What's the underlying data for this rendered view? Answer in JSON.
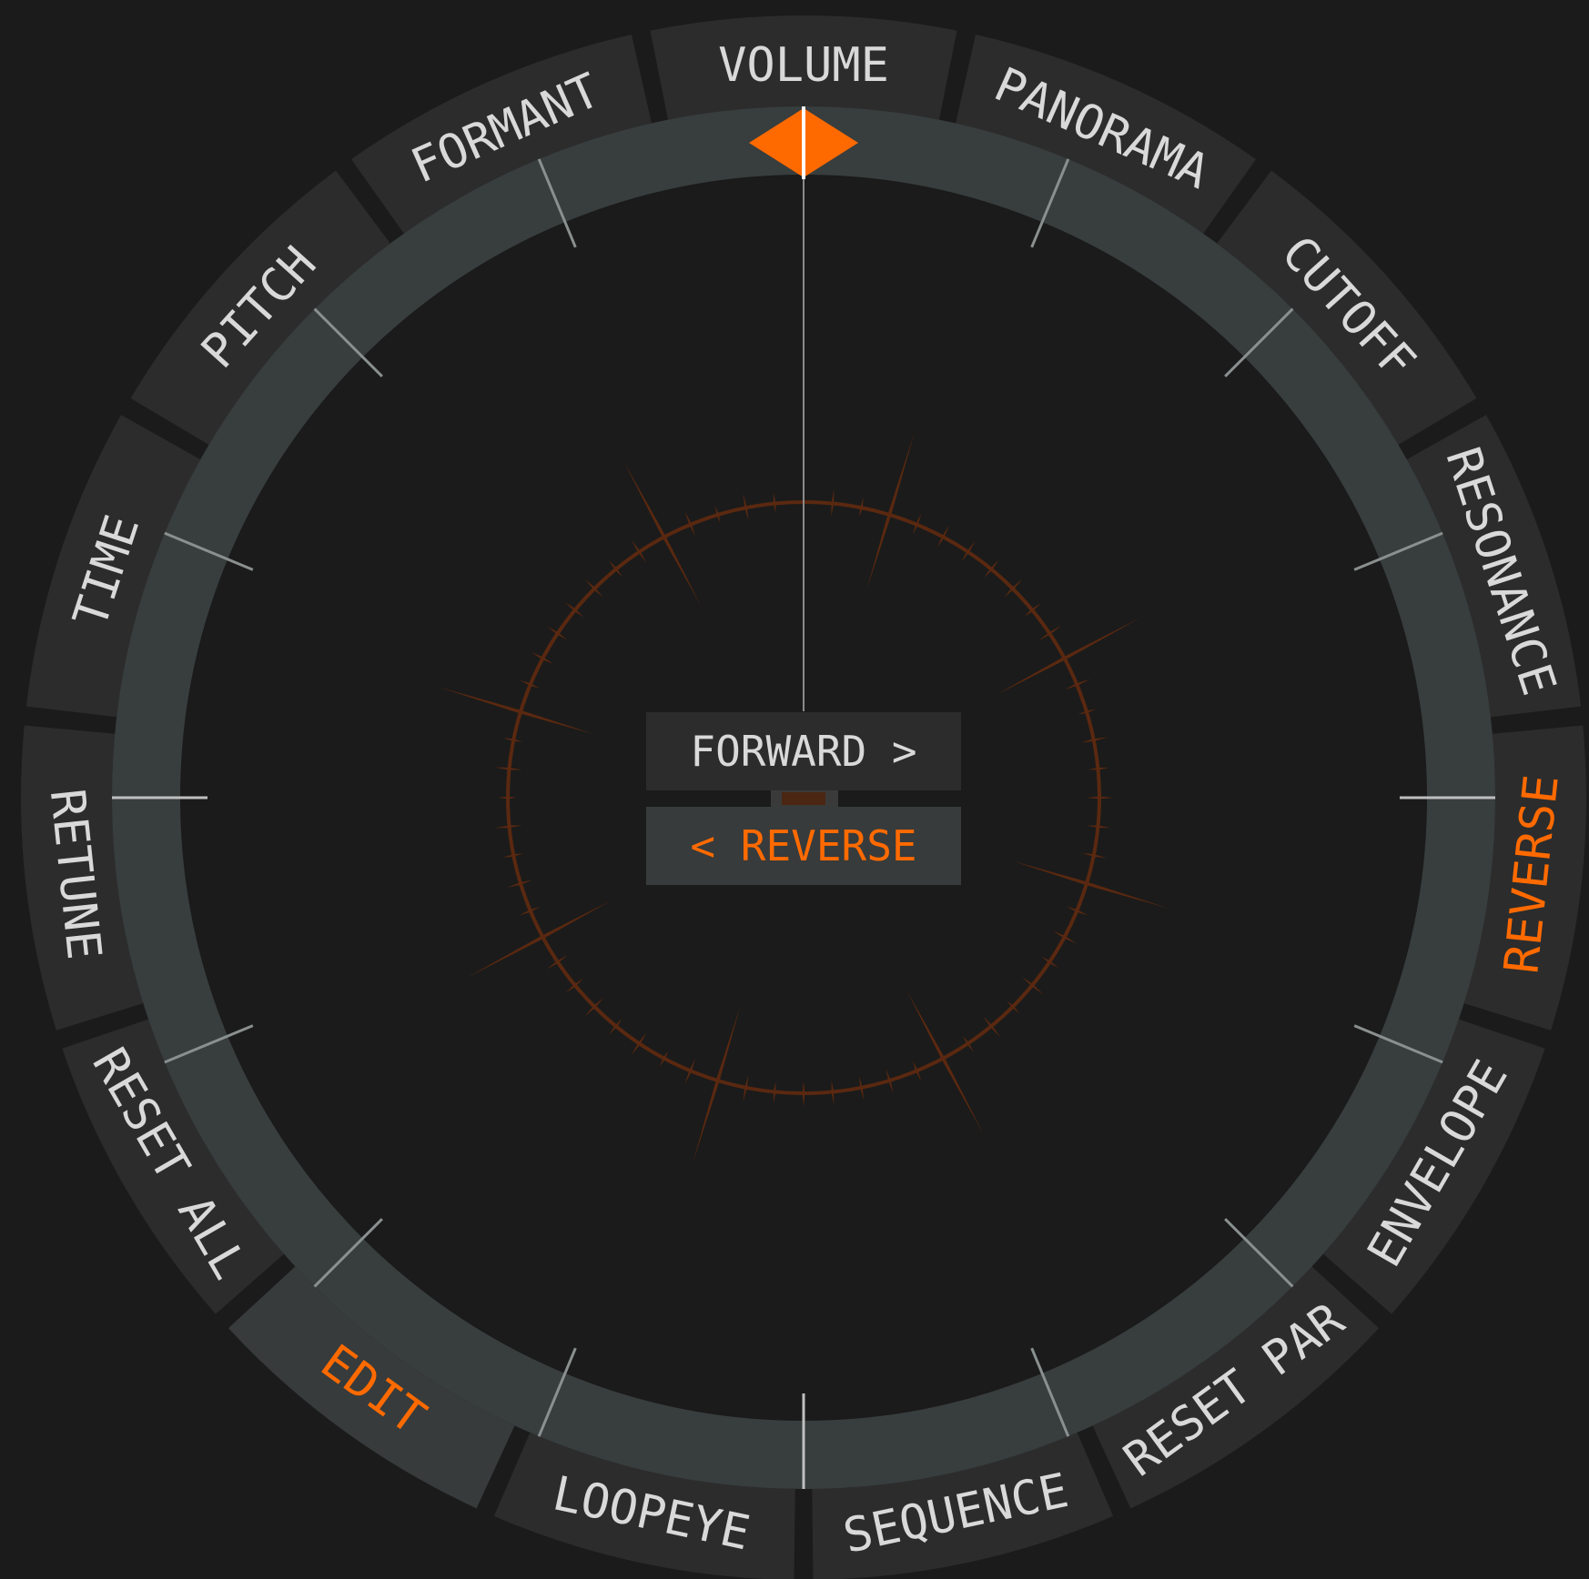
{
  "colors": {
    "background": "#1b1b1b",
    "segment": "#2c2c2c",
    "segment_active": "#373b3b",
    "ring": "#383d3d",
    "accent": "#ff6a00",
    "waveform": "#5a2810",
    "text": "#d9d9d9"
  },
  "segments": [
    {
      "id": "volume",
      "label": "VOLUME",
      "active": false
    },
    {
      "id": "panorama",
      "label": "PANORAMA",
      "active": false
    },
    {
      "id": "cutoff",
      "label": "CUTOFF",
      "active": false
    },
    {
      "id": "resonance",
      "label": "RESONANCE",
      "active": false
    },
    {
      "id": "reverse",
      "label": "REVERSE",
      "active": true
    },
    {
      "id": "envelope",
      "label": "ENVELOPE",
      "active": false
    },
    {
      "id": "reset-par",
      "label": "RESET PAR",
      "active": false
    },
    {
      "id": "sequence",
      "label": "SEQUENCE",
      "active": false
    },
    {
      "id": "loopeye",
      "label": "LOOPEYE",
      "active": false
    },
    {
      "id": "edit",
      "label": "EDIT",
      "active": true
    },
    {
      "id": "reset-all",
      "label": "RESET ALL",
      "active": false
    },
    {
      "id": "retune",
      "label": "RETUNE",
      "active": false
    },
    {
      "id": "time",
      "label": "TIME",
      "active": false
    },
    {
      "id": "pitch",
      "label": "PITCH",
      "active": false
    },
    {
      "id": "formant",
      "label": "FORMANT",
      "active": false
    }
  ],
  "center": {
    "forward_label": "FORWARD >",
    "reverse_label": "< REVERSE",
    "selected": "reverse"
  },
  "playhead": {
    "position": 0
  }
}
